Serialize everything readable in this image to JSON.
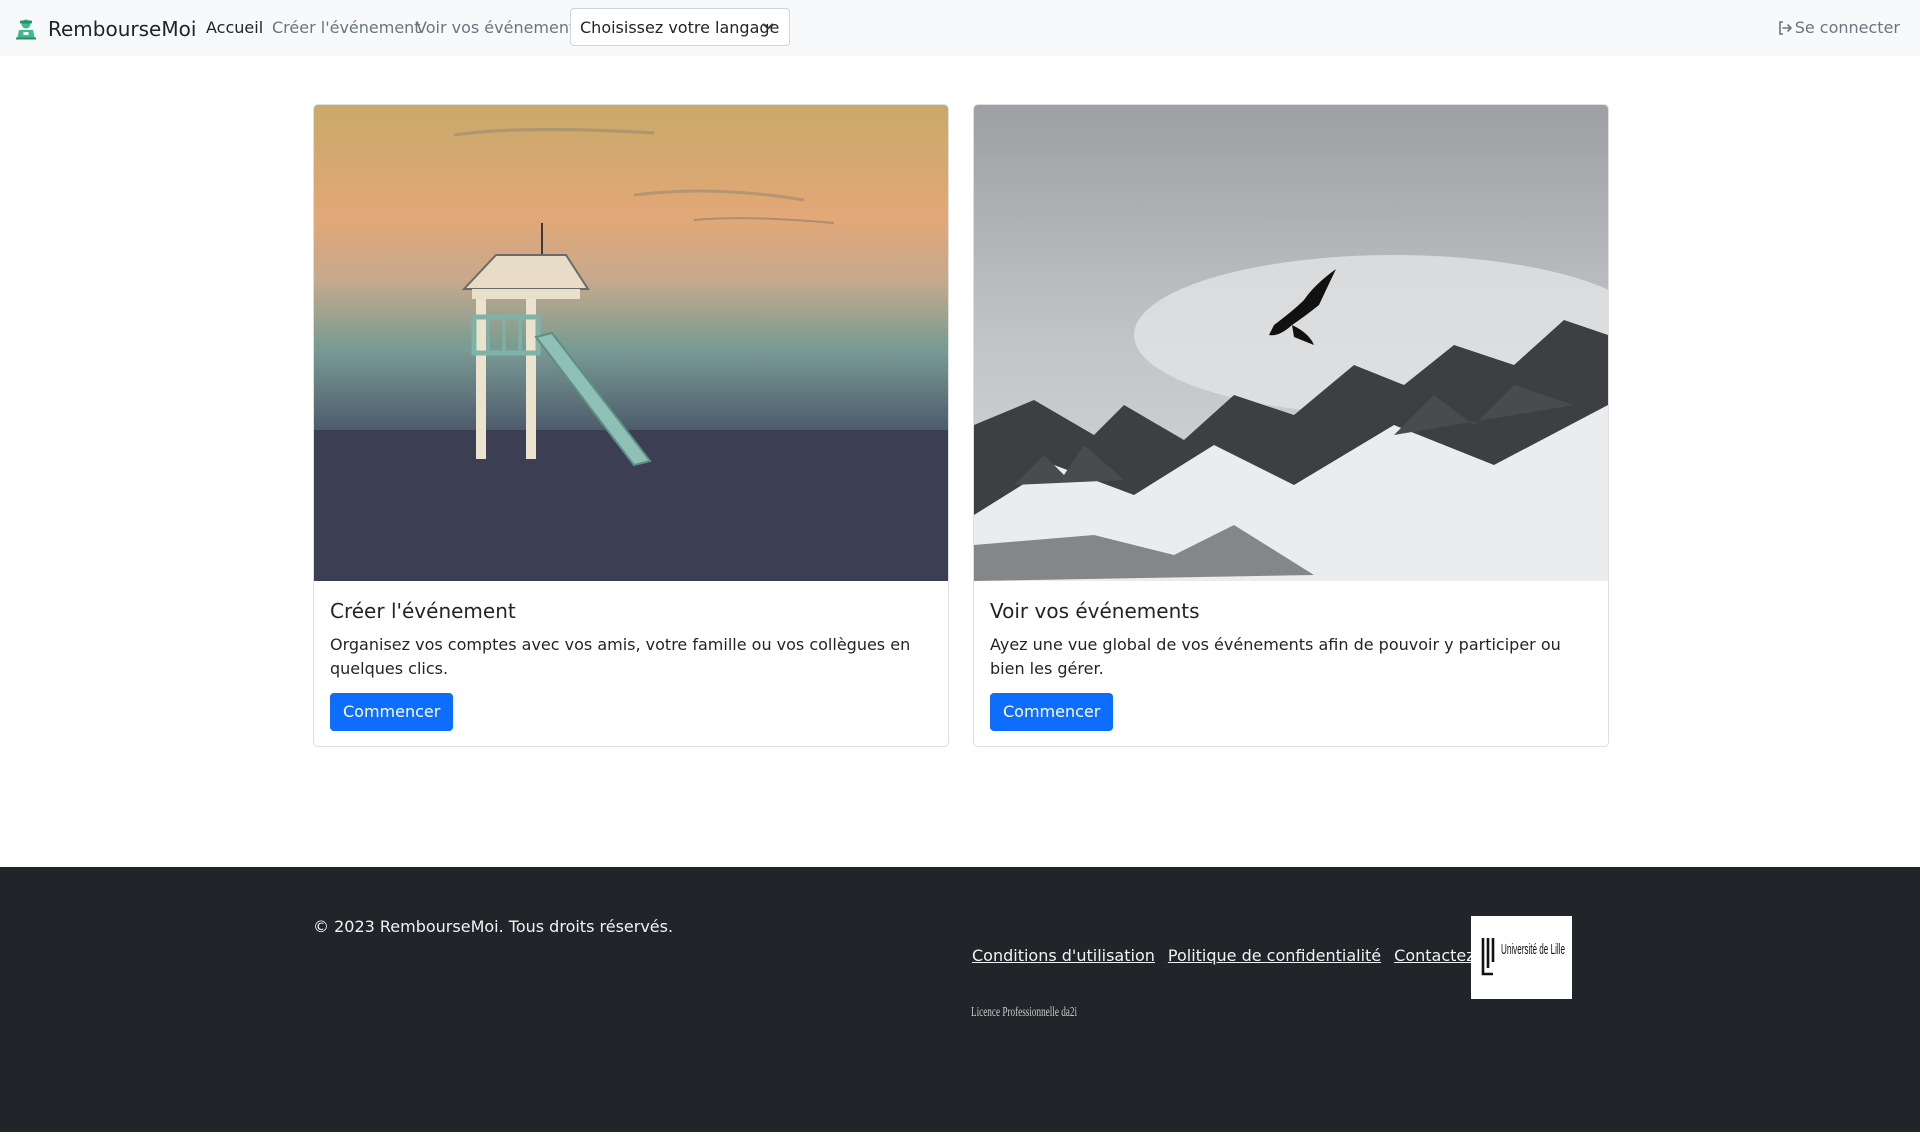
{
  "navbar": {
    "brand": "RembourseMoi",
    "links": [
      {
        "label": "Accueil",
        "active": true
      },
      {
        "label": "Créer l'événement",
        "active": false
      },
      {
        "label": "Voir vos événements",
        "active": false
      }
    ],
    "language_select": {
      "value": "Choisissez votre langage"
    },
    "login_label": "Se connecter"
  },
  "cards": [
    {
      "image": "beach-lifeguard-tower",
      "title": "Créer l'événement",
      "text": "Organisez vos comptes avec vos amis, votre famille ou vos collègues en quelques clics.",
      "button": "Commencer"
    },
    {
      "image": "snowy-mountain-eagle",
      "title": "Voir vos événements",
      "text": "Ayez une vue global de vos événements afin de pouvoir y participer ou bien les gérer.",
      "button": "Commencer"
    }
  ],
  "footer": {
    "copyright": "© 2023 RembourseMoi. Tous droits réservés.",
    "links": [
      "Conditions d'utilisation",
      "Politique de confidentialité",
      "Contactez-nous"
    ],
    "logos": [
      {
        "name": "universite-de-lille",
        "text": "Université de Lille"
      },
      {
        "name": "da2i",
        "text": "Licence Professionnelle da2i"
      }
    ]
  },
  "colors": {
    "navbar_bg": "#f8f9fa",
    "primary": "#0d6efd",
    "footer_bg": "#212529",
    "brand_icon": "#3dbb8d"
  }
}
